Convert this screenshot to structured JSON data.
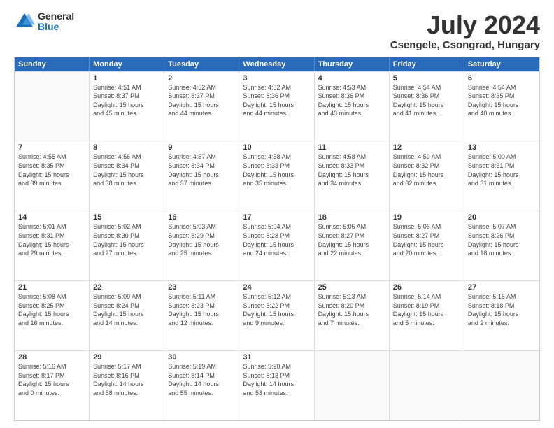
{
  "logo": {
    "general": "General",
    "blue": "Blue"
  },
  "title": "July 2024",
  "subtitle": "Csengele, Csongrad, Hungary",
  "header_days": [
    "Sunday",
    "Monday",
    "Tuesday",
    "Wednesday",
    "Thursday",
    "Friday",
    "Saturday"
  ],
  "weeks": [
    [
      {
        "date": "",
        "info": ""
      },
      {
        "date": "1",
        "info": "Sunrise: 4:51 AM\nSunset: 8:37 PM\nDaylight: 15 hours\nand 45 minutes."
      },
      {
        "date": "2",
        "info": "Sunrise: 4:52 AM\nSunset: 8:37 PM\nDaylight: 15 hours\nand 44 minutes."
      },
      {
        "date": "3",
        "info": "Sunrise: 4:52 AM\nSunset: 8:36 PM\nDaylight: 15 hours\nand 44 minutes."
      },
      {
        "date": "4",
        "info": "Sunrise: 4:53 AM\nSunset: 8:36 PM\nDaylight: 15 hours\nand 43 minutes."
      },
      {
        "date": "5",
        "info": "Sunrise: 4:54 AM\nSunset: 8:36 PM\nDaylight: 15 hours\nand 41 minutes."
      },
      {
        "date": "6",
        "info": "Sunrise: 4:54 AM\nSunset: 8:35 PM\nDaylight: 15 hours\nand 40 minutes."
      }
    ],
    [
      {
        "date": "7",
        "info": "Sunrise: 4:55 AM\nSunset: 8:35 PM\nDaylight: 15 hours\nand 39 minutes."
      },
      {
        "date": "8",
        "info": "Sunrise: 4:56 AM\nSunset: 8:34 PM\nDaylight: 15 hours\nand 38 minutes."
      },
      {
        "date": "9",
        "info": "Sunrise: 4:57 AM\nSunset: 8:34 PM\nDaylight: 15 hours\nand 37 minutes."
      },
      {
        "date": "10",
        "info": "Sunrise: 4:58 AM\nSunset: 8:33 PM\nDaylight: 15 hours\nand 35 minutes."
      },
      {
        "date": "11",
        "info": "Sunrise: 4:58 AM\nSunset: 8:33 PM\nDaylight: 15 hours\nand 34 minutes."
      },
      {
        "date": "12",
        "info": "Sunrise: 4:59 AM\nSunset: 8:32 PM\nDaylight: 15 hours\nand 32 minutes."
      },
      {
        "date": "13",
        "info": "Sunrise: 5:00 AM\nSunset: 8:31 PM\nDaylight: 15 hours\nand 31 minutes."
      }
    ],
    [
      {
        "date": "14",
        "info": "Sunrise: 5:01 AM\nSunset: 8:31 PM\nDaylight: 15 hours\nand 29 minutes."
      },
      {
        "date": "15",
        "info": "Sunrise: 5:02 AM\nSunset: 8:30 PM\nDaylight: 15 hours\nand 27 minutes."
      },
      {
        "date": "16",
        "info": "Sunrise: 5:03 AM\nSunset: 8:29 PM\nDaylight: 15 hours\nand 25 minutes."
      },
      {
        "date": "17",
        "info": "Sunrise: 5:04 AM\nSunset: 8:28 PM\nDaylight: 15 hours\nand 24 minutes."
      },
      {
        "date": "18",
        "info": "Sunrise: 5:05 AM\nSunset: 8:27 PM\nDaylight: 15 hours\nand 22 minutes."
      },
      {
        "date": "19",
        "info": "Sunrise: 5:06 AM\nSunset: 8:27 PM\nDaylight: 15 hours\nand 20 minutes."
      },
      {
        "date": "20",
        "info": "Sunrise: 5:07 AM\nSunset: 8:26 PM\nDaylight: 15 hours\nand 18 minutes."
      }
    ],
    [
      {
        "date": "21",
        "info": "Sunrise: 5:08 AM\nSunset: 8:25 PM\nDaylight: 15 hours\nand 16 minutes."
      },
      {
        "date": "22",
        "info": "Sunrise: 5:09 AM\nSunset: 8:24 PM\nDaylight: 15 hours\nand 14 minutes."
      },
      {
        "date": "23",
        "info": "Sunrise: 5:11 AM\nSunset: 8:23 PM\nDaylight: 15 hours\nand 12 minutes."
      },
      {
        "date": "24",
        "info": "Sunrise: 5:12 AM\nSunset: 8:22 PM\nDaylight: 15 hours\nand 9 minutes."
      },
      {
        "date": "25",
        "info": "Sunrise: 5:13 AM\nSunset: 8:20 PM\nDaylight: 15 hours\nand 7 minutes."
      },
      {
        "date": "26",
        "info": "Sunrise: 5:14 AM\nSunset: 8:19 PM\nDaylight: 15 hours\nand 5 minutes."
      },
      {
        "date": "27",
        "info": "Sunrise: 5:15 AM\nSunset: 8:18 PM\nDaylight: 15 hours\nand 2 minutes."
      }
    ],
    [
      {
        "date": "28",
        "info": "Sunrise: 5:16 AM\nSunset: 8:17 PM\nDaylight: 15 hours\nand 0 minutes."
      },
      {
        "date": "29",
        "info": "Sunrise: 5:17 AM\nSunset: 8:16 PM\nDaylight: 14 hours\nand 58 minutes."
      },
      {
        "date": "30",
        "info": "Sunrise: 5:19 AM\nSunset: 8:14 PM\nDaylight: 14 hours\nand 55 minutes."
      },
      {
        "date": "31",
        "info": "Sunrise: 5:20 AM\nSunset: 8:13 PM\nDaylight: 14 hours\nand 53 minutes."
      },
      {
        "date": "",
        "info": ""
      },
      {
        "date": "",
        "info": ""
      },
      {
        "date": "",
        "info": ""
      }
    ]
  ]
}
